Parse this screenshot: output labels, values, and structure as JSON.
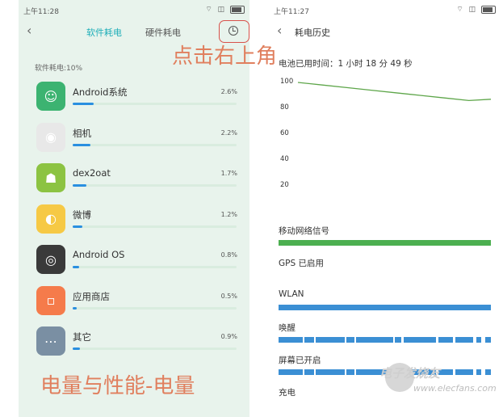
{
  "left": {
    "status": {
      "time": "上午11:28"
    },
    "header": {
      "tab_active": "软件耗电",
      "tab_inactive": "硬件耗电"
    },
    "summary": "软件耗电:10%",
    "apps": [
      {
        "name": "Android系统",
        "pct": "2.6%",
        "fraction": 0.26,
        "icon": "android-robot-icon",
        "color": "#3cb371"
      },
      {
        "name": "相机",
        "pct": "2.2%",
        "fraction": 0.22,
        "icon": "camera-icon",
        "color": "#e8e8e8"
      },
      {
        "name": "dex2oat",
        "pct": "1.7%",
        "fraction": 0.17,
        "icon": "android-icon",
        "color": "#8cc342"
      },
      {
        "name": "微博",
        "pct": "1.2%",
        "fraction": 0.12,
        "icon": "weibo-icon",
        "color": "#f6c945"
      },
      {
        "name": "Android OS",
        "pct": "0.8%",
        "fraction": 0.08,
        "icon": "android-os-icon",
        "color": "#3a3a3a"
      },
      {
        "name": "应用商店",
        "pct": "0.5%",
        "fraction": 0.05,
        "icon": "app-store-icon",
        "color": "#f57b4b"
      },
      {
        "name": "其它",
        "pct": "0.9%",
        "fraction": 0.09,
        "icon": "more-icon",
        "color": "#7a8fa3"
      }
    ],
    "caption": "电量与性能-电量"
  },
  "overlay_text": "点击右上角",
  "right": {
    "status": {
      "time": "上午11:27"
    },
    "title": "耗电历史",
    "duration": "电池已用时间：1 小时 18 分 49 秒",
    "yticks": [
      "100",
      "80",
      "60",
      "40",
      "20"
    ],
    "signals": [
      {
        "label": "移动网络信号",
        "color": "#4caf50",
        "type": "full"
      },
      {
        "label": "GPS 已启用",
        "color": "#3b8fd4",
        "type": "none"
      },
      {
        "label": "WLAN",
        "color": "#3b8fd4",
        "type": "full"
      },
      {
        "label": "唤醒",
        "color": "#3b8fd4",
        "type": "segments"
      },
      {
        "label": "屏幕已开启",
        "color": "#3b8fd4",
        "type": "segments"
      },
      {
        "label": "充电",
        "color": "#4caf50",
        "type": "none"
      }
    ]
  },
  "chart_data": {
    "type": "line",
    "x": [
      0,
      10,
      20,
      30,
      40,
      50,
      60,
      70,
      79
    ],
    "series": [
      {
        "values": [
          100,
          98,
          96,
          94,
          92,
          90,
          88,
          86,
          87
        ]
      }
    ],
    "ylim": [
      0,
      100
    ],
    "yticks": [
      100,
      80,
      60,
      40,
      20
    ],
    "grid": false
  },
  "watermark": {
    "text": "电子发烧友",
    "url": "www.elecfans.com"
  }
}
